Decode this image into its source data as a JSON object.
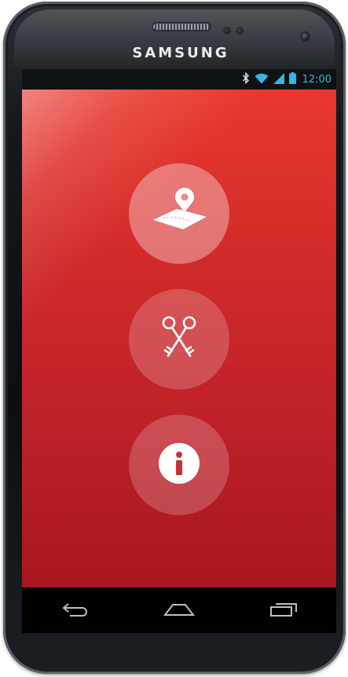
{
  "device": {
    "brand": "SAMSUNG"
  },
  "status_bar": {
    "time": "12:00",
    "icons": [
      "bluetooth-icon",
      "wifi-icon",
      "signal-icon",
      "battery-icon"
    ],
    "color": "#33b5e5"
  },
  "app": {
    "background_top": "#e9382e",
    "background_bottom": "#a8161f",
    "actions": [
      {
        "icon": "map-pin-icon"
      },
      {
        "icon": "keys-icon"
      },
      {
        "icon": "info-icon"
      }
    ]
  },
  "nav_bar": {
    "buttons": [
      "back-icon",
      "home-icon",
      "recent-apps-icon"
    ]
  }
}
